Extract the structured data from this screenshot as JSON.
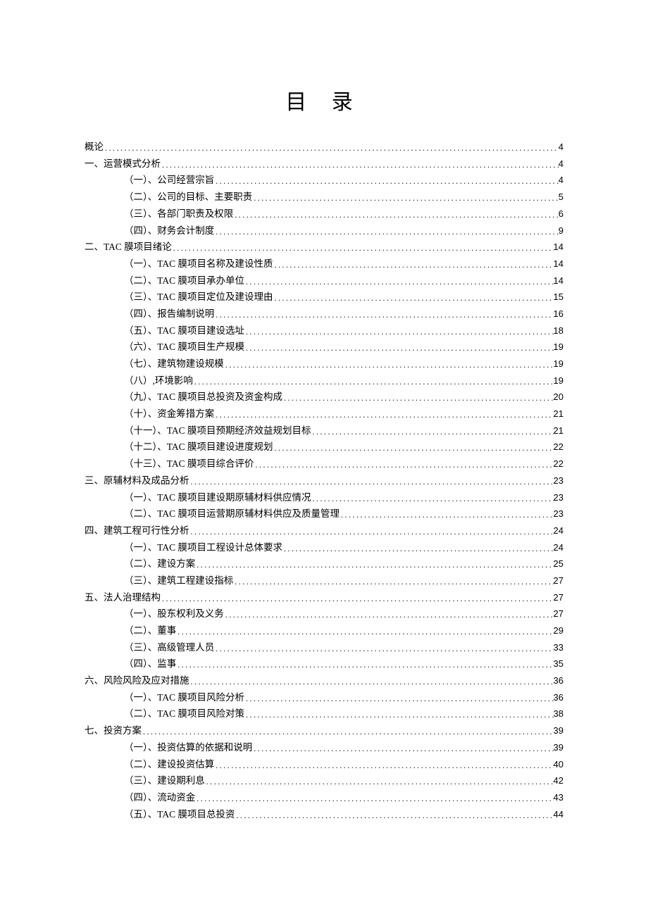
{
  "title": "目 录",
  "toc": [
    {
      "level": 0,
      "label": "概论",
      "page": "4"
    },
    {
      "level": 0,
      "label": "一、运营模式分析",
      "page": "4"
    },
    {
      "level": 1,
      "label": "（一）、公司经营宗旨",
      "page": "4"
    },
    {
      "level": 1,
      "label": "（二）、公司的目标、主要职责",
      "page": "5"
    },
    {
      "level": 1,
      "label": "（三）、各部门职责及权限",
      "page": "6"
    },
    {
      "level": 1,
      "label": "（四）、财务会计制度",
      "page": "9"
    },
    {
      "level": 0,
      "label": "二、TAC 膜项目绪论",
      "page": "14"
    },
    {
      "level": 1,
      "label": "（一）、TAC 膜项目名称及建设性质",
      "page": "14"
    },
    {
      "level": 1,
      "label": "（二）、TAC 膜项目承办单位",
      "page": "14"
    },
    {
      "level": 1,
      "label": "（三）、TAC 膜项目定位及建设理由",
      "page": "15"
    },
    {
      "level": 1,
      "label": "（四）、报告编制说明",
      "page": "16"
    },
    {
      "level": 1,
      "label": "（五）、TAC 膜项目建设选址",
      "page": "18"
    },
    {
      "level": 1,
      "label": "（六）、TAC 膜项目生产规模",
      "page": "19"
    },
    {
      "level": 1,
      "label": "（七）、建筑物建设规模",
      "page": "19"
    },
    {
      "level": 1,
      "label": "（八）,环境影响",
      "page": "19"
    },
    {
      "level": 1,
      "label": "（九）、TAC 膜项目总投资及资金构成",
      "page": "20"
    },
    {
      "level": 1,
      "label": "（十）、资金筹措方案",
      "page": "21"
    },
    {
      "level": 1,
      "label": "（十一）、TAC 膜项目预期经济效益规划目标",
      "page": "21"
    },
    {
      "level": 1,
      "label": "（十二）、TAC 膜项目建设进度规划",
      "page": "22"
    },
    {
      "level": 1,
      "label": "（十三）、TAC 膜项目综合评价",
      "page": "22"
    },
    {
      "level": 0,
      "label": "三、原辅材料及成品分析",
      "page": "23"
    },
    {
      "level": 1,
      "label": "（一）、TAC 膜项目建设期原辅材料供应情况",
      "page": "23"
    },
    {
      "level": 1,
      "label": "（二）、TAC 膜项目运营期原辅材料供应及质量管理",
      "page": "23"
    },
    {
      "level": 0,
      "label": "四、建筑工程可行性分析",
      "page": "24"
    },
    {
      "level": 1,
      "label": "（一）、TAC 膜项目工程设计总体要求",
      "page": "24"
    },
    {
      "level": 1,
      "label": "（二）、建设方案",
      "page": "25"
    },
    {
      "level": 1,
      "label": "（三）、建筑工程建设指标",
      "page": "27"
    },
    {
      "level": 0,
      "label": "五、法人治理结构",
      "page": "27"
    },
    {
      "level": 1,
      "label": "（一）、股东权利及义务",
      "page": "27"
    },
    {
      "level": 1,
      "label": "（二）、董事",
      "page": "29"
    },
    {
      "level": 1,
      "label": "（三）、高级管理人员",
      "page": "33"
    },
    {
      "level": 1,
      "label": "（四）、监事",
      "page": "35"
    },
    {
      "level": 0,
      "label": "六、风险风险及应对措施",
      "page": "36"
    },
    {
      "level": 1,
      "label": "（一）、TAC 膜项目风险分析",
      "page": "36"
    },
    {
      "level": 1,
      "label": "（二）、TAC 膜项目风险对策",
      "page": "38"
    },
    {
      "level": 0,
      "label": "七、投资方案",
      "page": "39"
    },
    {
      "level": 1,
      "label": "（一）、投资估算的依据和说明",
      "page": "39"
    },
    {
      "level": 1,
      "label": "（二）、建设投资估算",
      "page": "40"
    },
    {
      "level": 1,
      "label": "（三）、建设期利息",
      "page": "42"
    },
    {
      "level": 1,
      "label": "（四）、流动资金",
      "page": "43"
    },
    {
      "level": 1,
      "label": "（五）、TAC 膜项目总投资",
      "page": "44"
    }
  ]
}
